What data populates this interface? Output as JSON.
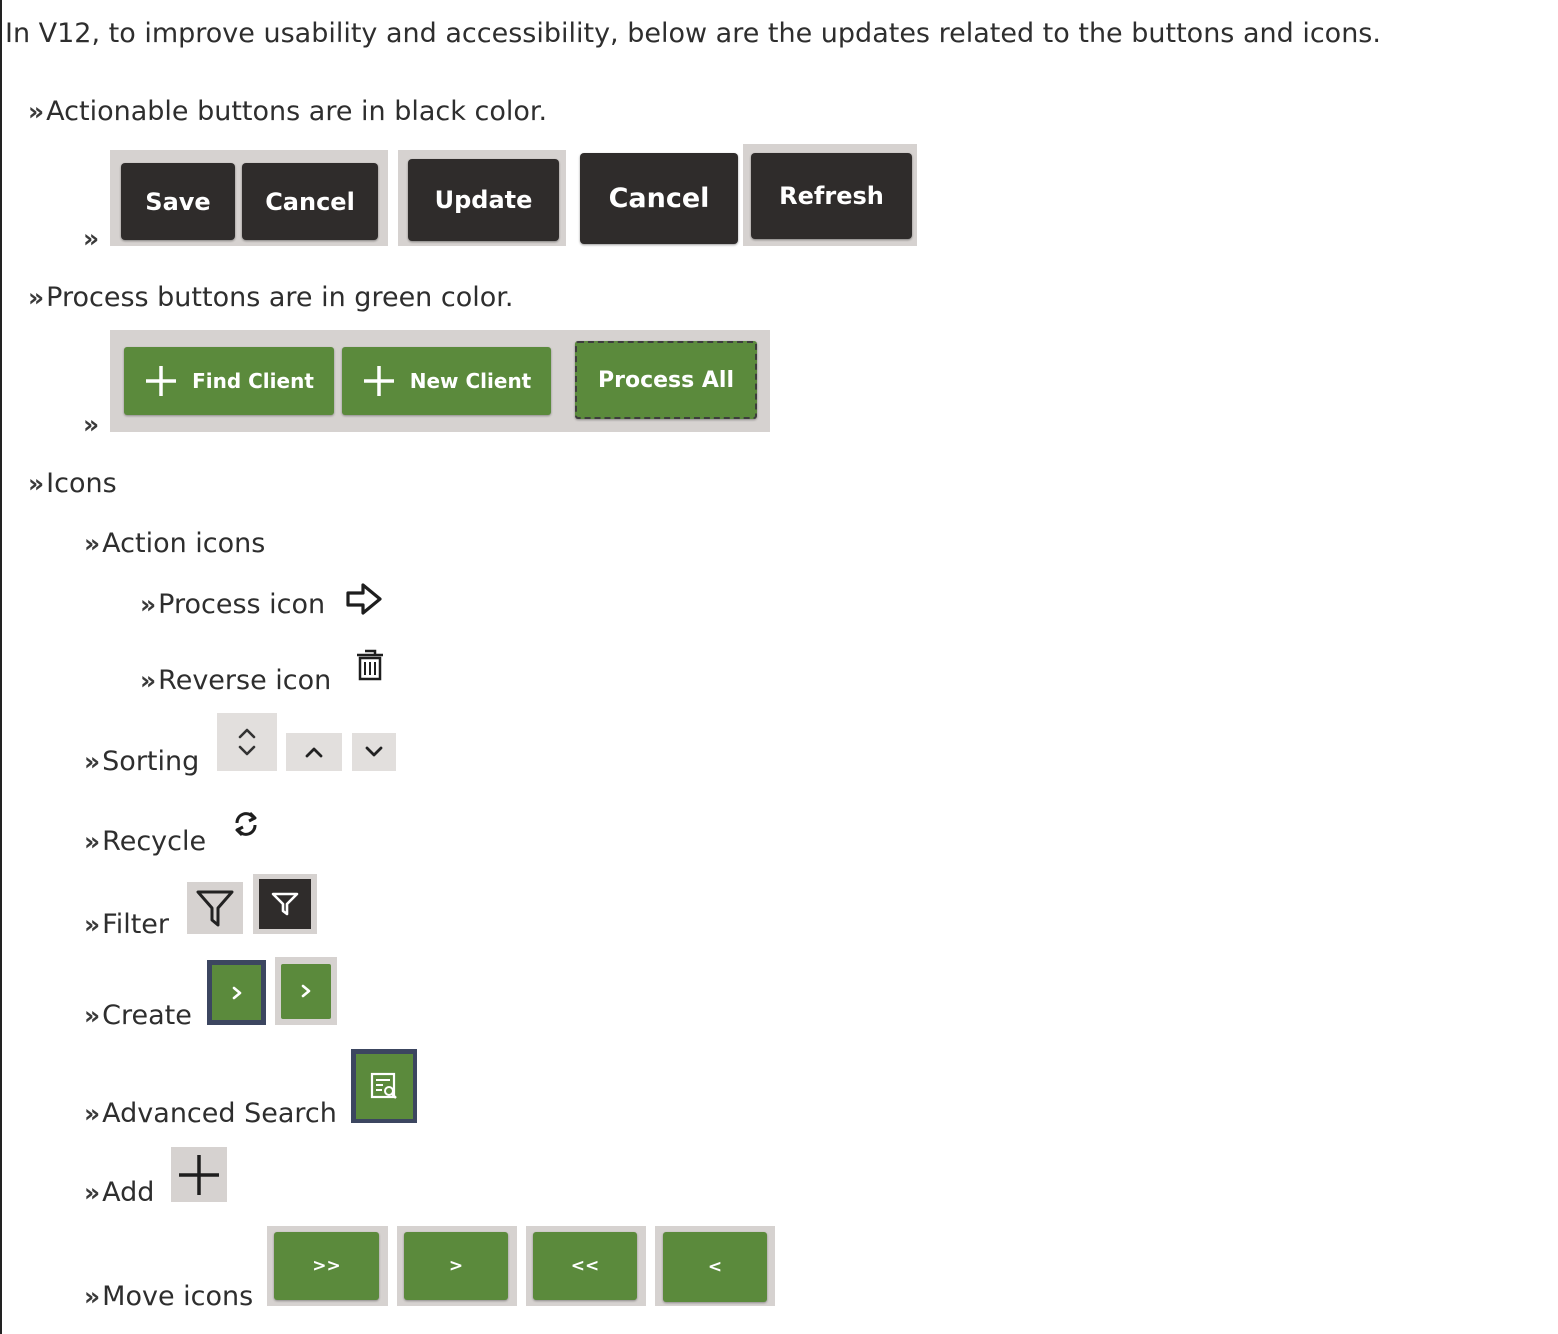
{
  "intro": "In V12, to improve usability and accessibility, below are the updates related to the buttons and icons.",
  "bullet": "»",
  "sections": {
    "actionable": {
      "label": "Actionable buttons are in black color.",
      "buttons": [
        "Save",
        "Cancel",
        "Update",
        "Cancel",
        "Refresh"
      ]
    },
    "process": {
      "label": "Process buttons are in green color.",
      "buttons": [
        "Find Client",
        "New Client",
        "Process All"
      ]
    },
    "icons": {
      "label": "Icons",
      "action_icons": {
        "label": "Action icons",
        "process_icon": "Process icon",
        "reverse_icon": "Reverse icon"
      },
      "sorting": "Sorting",
      "recycle": "Recycle",
      "filter": "Filter",
      "create": "Create",
      "advanced_search": "Advanced Search",
      "add": "Add",
      "move_icons": {
        "label": "Move icons",
        "buttons": [
          ">>",
          ">",
          "<<",
          "<"
        ]
      }
    }
  },
  "colors": {
    "dark_button": "#2f2c2b",
    "green_button": "#5b8a3c",
    "frame_gray": "#d6d2d0"
  },
  "icon_names": [
    "arrow-right-icon",
    "trash-icon",
    "sort-both-icon",
    "sort-up-icon",
    "sort-down-icon",
    "recycle-icon",
    "filter-icon",
    "filter-active-icon",
    "chevron-right-icon",
    "advanced-search-icon",
    "plus-icon"
  ]
}
